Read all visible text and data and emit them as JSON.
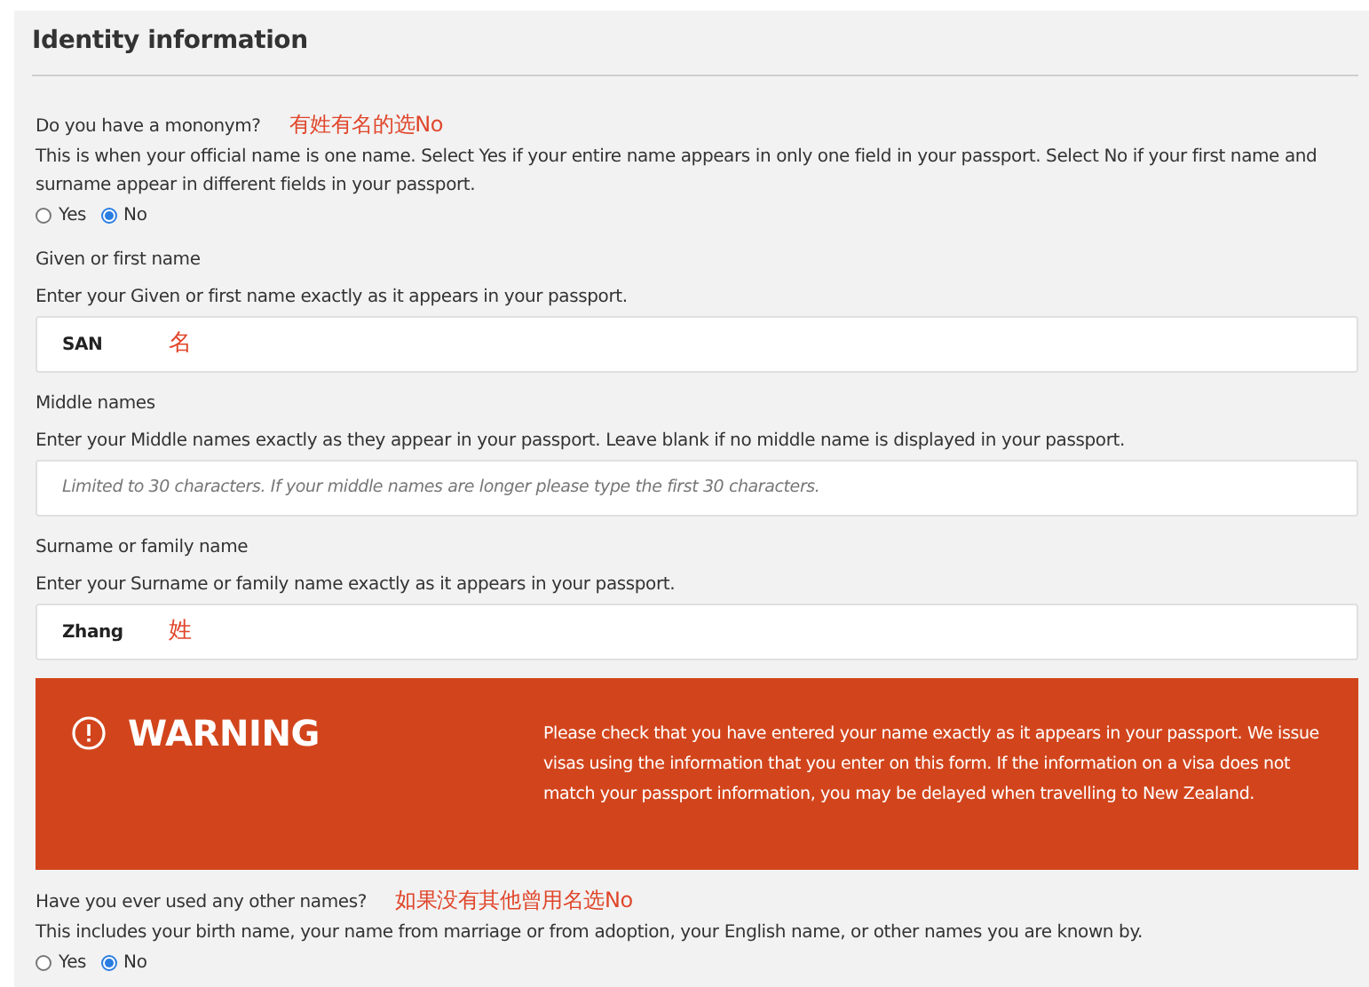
{
  "section_title": "Identity information",
  "items": [
    {
      "kind": "radio",
      "label": "Do you have a mononym?",
      "note": "有姓有名的选No",
      "help": "This is when your official name is one name. Select Yes if your entire name appears in only one field in your passport. Select No if your first name and surname appear in different fields in your passport.",
      "options": [
        {
          "label": "Yes",
          "selected": false
        },
        {
          "label": "No",
          "selected": true
        }
      ]
    },
    {
      "kind": "text",
      "label": "Given or first name",
      "help": "Enter your Given or first name exactly as it appears in your passport.",
      "value": "SAN",
      "note": "名"
    },
    {
      "kind": "text",
      "label": "Middle names",
      "help": "Enter your Middle names exactly as they appear in your passport. Leave blank if no middle name is displayed in your passport.",
      "placeholder": "Limited to 30 characters. If your middle names are longer please type the first 30 characters."
    },
    {
      "kind": "text",
      "label": "Surname or family name",
      "help": "Enter your Surname or family name exactly as it appears in your passport.",
      "value": "Zhang",
      "note": "姓"
    },
    {
      "kind": "warning",
      "title": "WARNING",
      "text": "Please check that you have entered your name exactly as it appears in your passport. We issue visas using the information that you enter on this form. If the information on a visa does not match your passport information, you may be delayed when travelling to New Zealand."
    },
    {
      "kind": "radio",
      "label": "Have you ever used any other names?",
      "note": "如果没有其他曾用名选No",
      "help": "This includes your birth name, your name from marriage or from adoption, your English name, or other names you are known by.",
      "options": [
        {
          "label": "Yes",
          "selected": false
        },
        {
          "label": "No",
          "selected": true
        }
      ]
    }
  ]
}
